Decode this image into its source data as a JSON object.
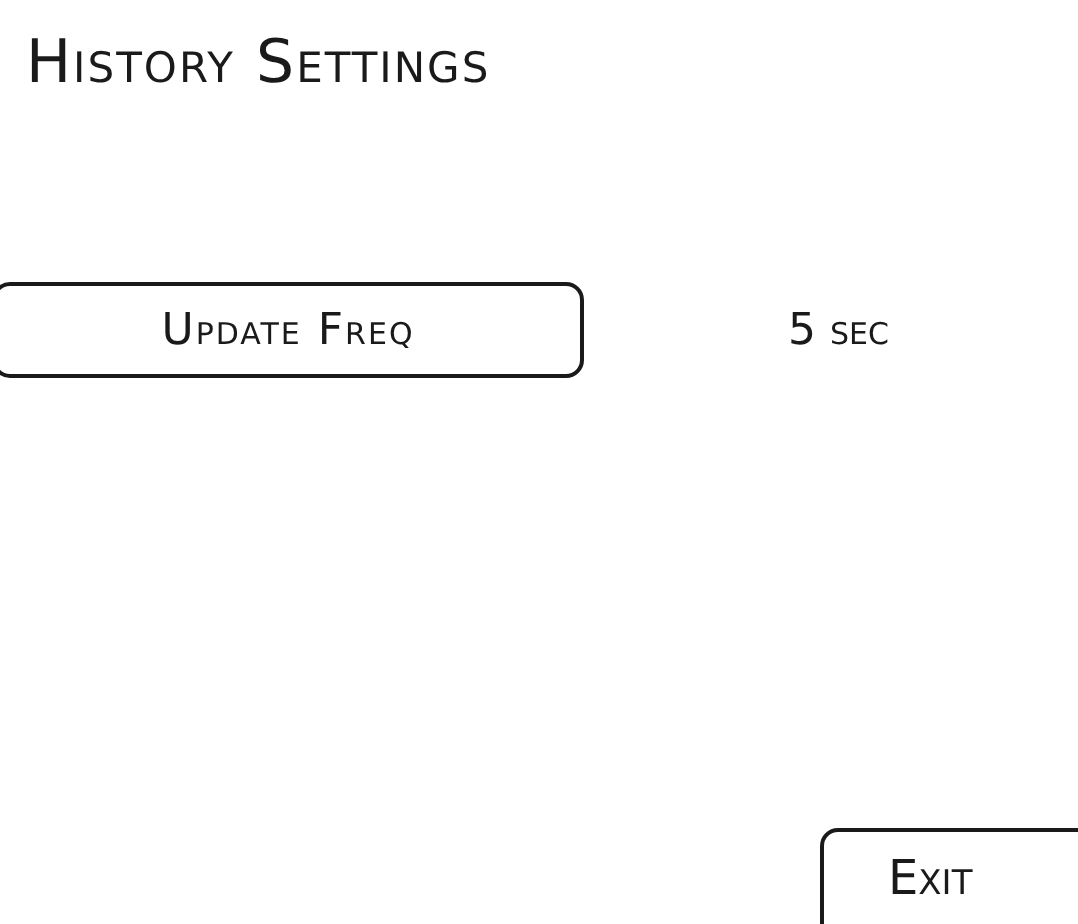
{
  "title": "History Settings",
  "settings": [
    {
      "label": "Update Freq",
      "value": "5 sec"
    }
  ],
  "buttons": [
    {
      "label": "Exit"
    }
  ]
}
